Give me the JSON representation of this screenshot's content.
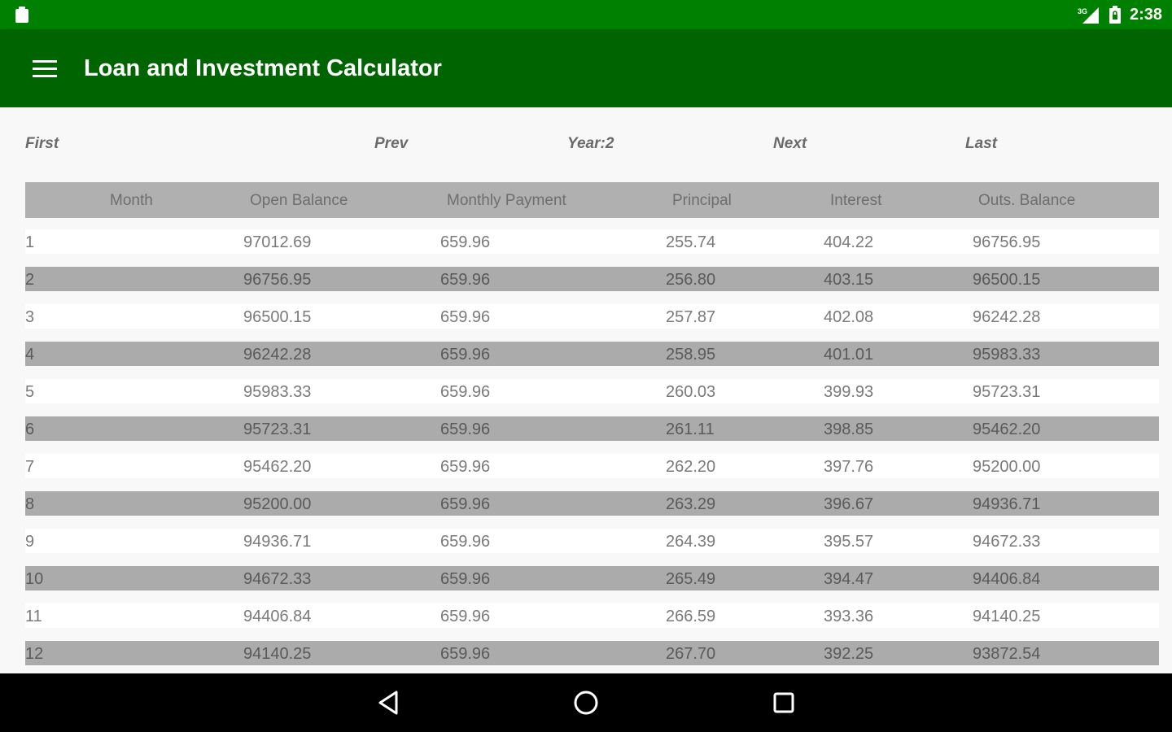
{
  "status_bar": {
    "time": "2:38",
    "network_label": "3G"
  },
  "app_bar": {
    "title": "Loan and Investment Calculator"
  },
  "pager": {
    "first": "First",
    "prev": "Prev",
    "year": "Year:2",
    "next": "Next",
    "last": "Last"
  },
  "table": {
    "headers": [
      "Month",
      "Open Balance",
      "Monthly Payment",
      "Principal",
      "Interest",
      "Outs. Balance"
    ],
    "rows": [
      [
        "1",
        "97012.69",
        "659.96",
        "255.74",
        "404.22",
        "96756.95"
      ],
      [
        "2",
        "96756.95",
        "659.96",
        "256.80",
        "403.15",
        "96500.15"
      ],
      [
        "3",
        "96500.15",
        "659.96",
        "257.87",
        "402.08",
        "96242.28"
      ],
      [
        "4",
        "96242.28",
        "659.96",
        "258.95",
        "401.01",
        "95983.33"
      ],
      [
        "5",
        "95983.33",
        "659.96",
        "260.03",
        "399.93",
        "95723.31"
      ],
      [
        "6",
        "95723.31",
        "659.96",
        "261.11",
        "398.85",
        "95462.20"
      ],
      [
        "7",
        "95462.20",
        "659.96",
        "262.20",
        "397.76",
        "95200.00"
      ],
      [
        "8",
        "95200.00",
        "659.96",
        "263.29",
        "396.67",
        "94936.71"
      ],
      [
        "9",
        "94936.71",
        "659.96",
        "264.39",
        "395.57",
        "94672.33"
      ],
      [
        "10",
        "94672.33",
        "659.96",
        "265.49",
        "394.47",
        "94406.84"
      ],
      [
        "11",
        "94406.84",
        "659.96",
        "266.59",
        "393.36",
        "94140.25"
      ],
      [
        "12",
        "94140.25",
        "659.96",
        "267.70",
        "392.25",
        "93872.54"
      ]
    ]
  },
  "colors": {
    "status_bar": "#008000",
    "app_bar": "#006400",
    "header_row": "#b0b0b0",
    "alt_row": "#ababab"
  }
}
